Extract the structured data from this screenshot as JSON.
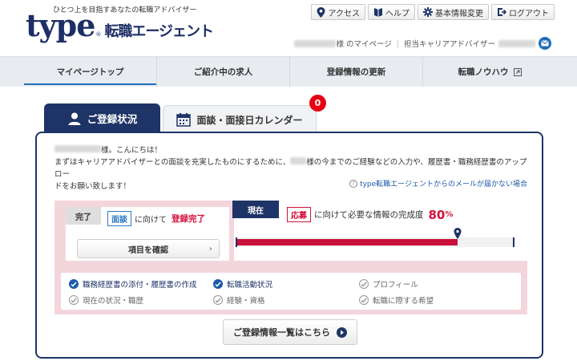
{
  "header": {
    "tagline": "ひとつ上を目指すあなたの転職アドバイザー",
    "logo_main": "type",
    "logo_reg": "®",
    "logo_sub": "転職エージェント",
    "nav": [
      {
        "label": "アクセス",
        "icon": "map-pin-icon"
      },
      {
        "label": "ヘルプ",
        "icon": "help-book-icon"
      },
      {
        "label": "基本情報変更",
        "icon": "gear-icon"
      },
      {
        "label": "ログアウト",
        "icon": "logout-icon"
      }
    ],
    "user_suffix": "様 のマイページ",
    "advisor_label": "担当キャリアアドバイザー"
  },
  "mainnav": [
    {
      "label": "マイページトップ"
    },
    {
      "label": "ご紹介中の求人"
    },
    {
      "label": "登録情報の更新"
    },
    {
      "label": "転職ノウハウ"
    }
  ],
  "tabs": {
    "status_label": "ご登録状況",
    "calendar_label": "面談・面接日カレンダー",
    "calendar_badge": "0"
  },
  "greeting": {
    "line1_suffix": "様。こんにちは！",
    "line2_a": "まずはキャリアアドバイザーとの面談を充実したものにするために、",
    "line2_b": "様の今までのご経験などの入力や、履歴書・職務経歴書のアップロー",
    "line3": "ドをお願い致します！",
    "help_link": "type転職エージェントからのメールが届かない場合"
  },
  "status": {
    "done_label": "完了",
    "done_stage": "面談",
    "done_middle": "に向けて",
    "done_result": "登録完了",
    "check_button": "項目を確認",
    "now_label": "現在",
    "now_stage": "応募",
    "now_middle": "に向けて必要な情報の完成度",
    "percent_value": "80",
    "percent_sign": "%",
    "percent_fraction": 0.8
  },
  "checklist": [
    {
      "label": "職務経歴書の添付・履歴書の作成",
      "done": true
    },
    {
      "label": "転職活動状況",
      "done": true
    },
    {
      "label": "プロフィール",
      "done": false
    },
    {
      "label": "現在の状況・職歴",
      "done": false
    },
    {
      "label": "経験・資格",
      "done": false
    },
    {
      "label": "転職に際する希望",
      "done": false
    }
  ],
  "list_button": "ご登録情報一覧はこちら",
  "colors": {
    "navy": "#1e3466",
    "accent_red": "#d2113a",
    "pink_bg": "#f3d6dc",
    "link_blue": "#1e5aa8"
  }
}
